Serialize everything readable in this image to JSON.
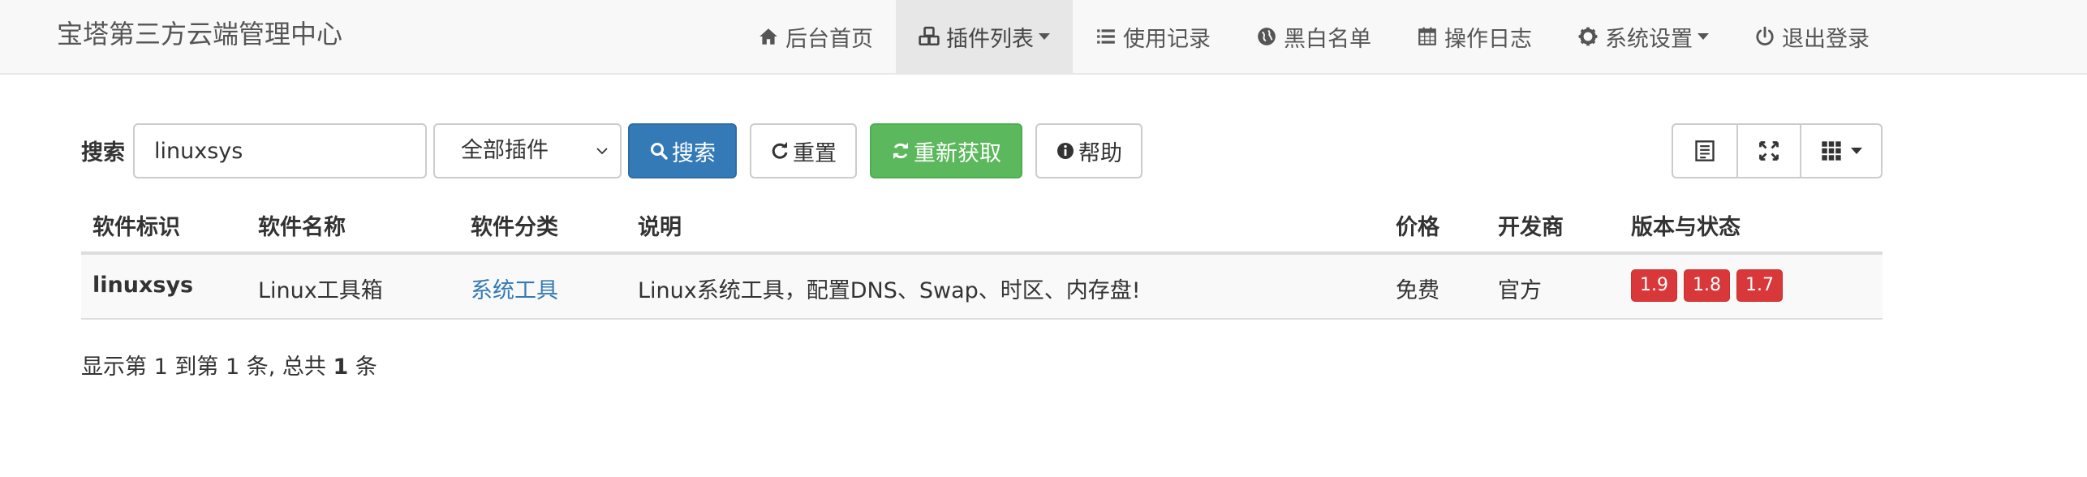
{
  "header": {
    "brand": "宝塔第三方云端管理中心",
    "nav": [
      {
        "label": "后台首页",
        "icon": "home-icon"
      },
      {
        "label": "插件列表",
        "icon": "cubes-icon",
        "active": true,
        "dropdown": true
      },
      {
        "label": "使用记录",
        "icon": "list-icon"
      },
      {
        "label": "黑白名单",
        "icon": "globe-icon"
      },
      {
        "label": "操作日志",
        "icon": "calendar-icon"
      },
      {
        "label": "系统设置",
        "icon": "gear-icon",
        "dropdown": true
      },
      {
        "label": "退出登录",
        "icon": "power-icon"
      }
    ]
  },
  "toolbar": {
    "search_label": "搜索",
    "search_value": "linuxsys",
    "category_select": "全部插件",
    "search_button": "搜索",
    "reset_button": "重置",
    "refetch_button": "重新获取",
    "help_button": "帮助"
  },
  "table": {
    "columns": [
      "软件标识",
      "软件名称",
      "软件分类",
      "说明",
      "价格",
      "开发商",
      "版本与状态"
    ],
    "rows": [
      {
        "id": "linuxsys",
        "name": "Linux工具箱",
        "category": "系统工具",
        "description": "Linux系统工具，配置DNS、Swap、时区、内存盘!",
        "price": "免费",
        "developer": "官方",
        "versions": [
          "1.9",
          "1.8",
          "1.7"
        ]
      }
    ]
  },
  "pagination": {
    "prefix": "显示第",
    "from": "1",
    "middle": "到第",
    "to": "1",
    "suffix_a": "条, 总共",
    "total": "1",
    "suffix_b": "条"
  },
  "colors": {
    "primary": "#337ab7",
    "success": "#5cb85c",
    "danger": "#d9383a"
  }
}
